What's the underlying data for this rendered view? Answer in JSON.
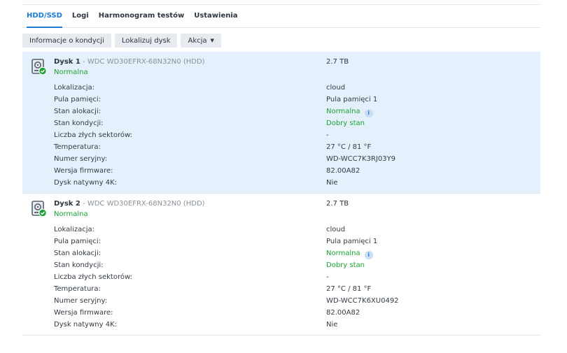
{
  "tabs": [
    {
      "label": "HDD/SSD",
      "active": true
    },
    {
      "label": "Logi",
      "active": false
    },
    {
      "label": "Harmonogram testów",
      "active": false
    },
    {
      "label": "Ustawienia",
      "active": false
    }
  ],
  "toolbar": {
    "health_label": "Informacje o kondycji",
    "locate_label": "Lokalizuj dysk",
    "action_label": "Akcja"
  },
  "colors": {
    "accent": "#1a7ad6",
    "status_green": "#1aa332",
    "selected_row": "#e4f1fc"
  },
  "disks": [
    {
      "name": "Dysk 1",
      "model": " - WDC WD30EFRX-68N32N0 (HDD)",
      "status": "Normalna",
      "size": "2.7 TB",
      "icon": "hdd-icon",
      "selected": true,
      "rows": [
        {
          "label": "Lokalizacja:",
          "value": "cloud"
        },
        {
          "label": "Pula pamięci:",
          "value": "Pula pamięci 1"
        },
        {
          "label": "Stan alokacji:",
          "value": "Normalna",
          "info": "i"
        },
        {
          "label": "Stan kondycji:",
          "value": "Dobry stan"
        },
        {
          "label": "Liczba złych sektorów:",
          "value": "-"
        },
        {
          "label": "Temperatura:",
          "value": "27 °C / 81 °F"
        },
        {
          "label": "Numer seryjny:",
          "value": "WD-WCC7K3RJ03Y9"
        },
        {
          "label": "Wersja firmware:",
          "value": "82.00A82"
        },
        {
          "label": "Dysk natywny 4K:",
          "value": "Nie"
        }
      ]
    },
    {
      "name": "Dysk 2",
      "model": " - WDC WD30EFRX-68N32N0 (HDD)",
      "status": "Normalna",
      "size": "2.7 TB",
      "icon": "hdd-icon",
      "selected": false,
      "rows": [
        {
          "label": "Lokalizacja:",
          "value": "cloud"
        },
        {
          "label": "Pula pamięci:",
          "value": "Pula pamięci 1"
        },
        {
          "label": "Stan alokacji:",
          "value": "Normalna",
          "info": "i"
        },
        {
          "label": "Stan kondycji:",
          "value": "Dobry stan"
        },
        {
          "label": "Liczba złych sektorów:",
          "value": "-"
        },
        {
          "label": "Temperatura:",
          "value": "27 °C / 81 °F"
        },
        {
          "label": "Numer seryjny:",
          "value": "WD-WCC7K6XU0492"
        },
        {
          "label": "Wersja firmware:",
          "value": "82.00A82"
        },
        {
          "label": "Dysk natywny 4K:",
          "value": "Nie"
        }
      ]
    }
  ]
}
